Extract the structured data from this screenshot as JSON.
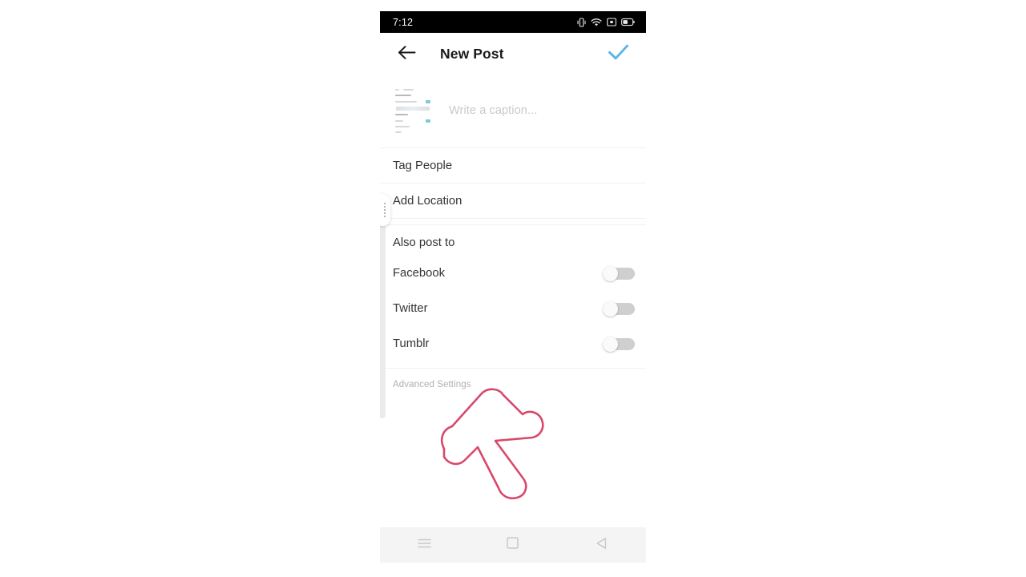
{
  "status_bar": {
    "time": "7:12",
    "icons": [
      {
        "name": "vibrate-icon",
        "label": "vibrate"
      },
      {
        "name": "wifi-icon",
        "label": "wifi"
      },
      {
        "name": "sim-card-icon",
        "label": "sim"
      },
      {
        "name": "battery-icon",
        "label": "battery"
      }
    ]
  },
  "app_bar": {
    "back_icon": "back-arrow-icon",
    "title": "New Post",
    "confirm_icon": "checkmark-icon",
    "confirm_color": "#5bb4e8"
  },
  "caption": {
    "placeholder": "Write a caption...",
    "thumbnail_name": "post-thumbnail"
  },
  "rows": [
    {
      "label": "Tag People",
      "name": "tag-people-row"
    },
    {
      "label": "Add Location",
      "name": "add-location-row"
    }
  ],
  "also_post_to": {
    "heading": "Also post to",
    "services": [
      {
        "label": "Facebook",
        "name": "facebook-toggle",
        "on": false
      },
      {
        "label": "Twitter",
        "name": "twitter-toggle",
        "on": false
      },
      {
        "label": "Tumblr",
        "name": "tumblr-toggle",
        "on": false
      }
    ]
  },
  "advanced_settings": {
    "label": "Advanced Settings"
  },
  "annotation": {
    "name": "red-arrow-annotation",
    "color": "#d9486b",
    "direction": "up-left"
  },
  "nav_bar": {
    "buttons": [
      {
        "name": "recents-button",
        "icon": "menu-lines-icon"
      },
      {
        "name": "home-button",
        "icon": "square-icon"
      },
      {
        "name": "back-button",
        "icon": "triangle-left-icon"
      }
    ]
  },
  "edge_handle": {
    "name": "edge-gesture-handle"
  }
}
